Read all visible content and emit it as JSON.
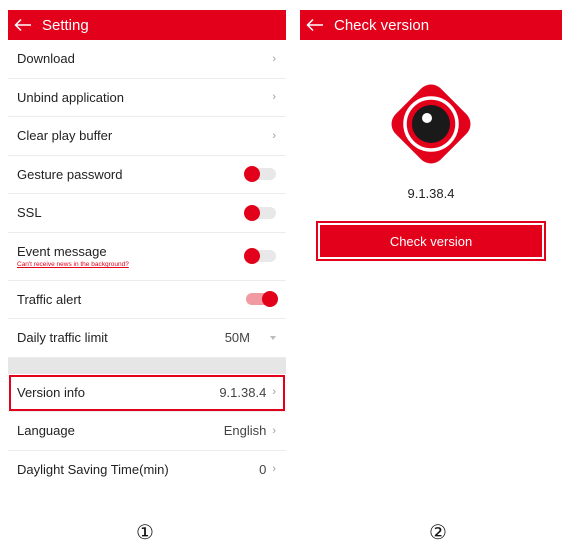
{
  "colors": {
    "accent": "#e3001b",
    "divider": "#ececec",
    "section_gap": "#e6e6e6"
  },
  "settings_screen": {
    "title": "Setting",
    "back_icon": "back-arrow-icon",
    "rows": {
      "download": "Download",
      "unbind": "Unbind application",
      "clear_buffer": "Clear play buffer",
      "gesture": "Gesture password",
      "ssl": "SSL",
      "event": "Event message",
      "event_warning": "Can't receive news in the background?",
      "traffic_alert": "Traffic alert",
      "daily_limit": "Daily traffic limit",
      "daily_limit_value": "50M",
      "version_info": "Version info",
      "version_value": "9.1.38.4",
      "language": "Language",
      "language_value": "English",
      "dst": "Daylight Saving Time(min)",
      "dst_value": "0"
    },
    "toggles": {
      "gesture": false,
      "ssl": false,
      "event": false,
      "traffic_alert": true
    },
    "chevron": "›"
  },
  "check_screen": {
    "title": "Check version",
    "back_icon": "back-arrow-icon",
    "logo_icon": "camera-eye-logo-icon",
    "version": "9.1.38.4",
    "button_label": "Check version"
  },
  "captions": {
    "first": "①",
    "second": "②"
  }
}
